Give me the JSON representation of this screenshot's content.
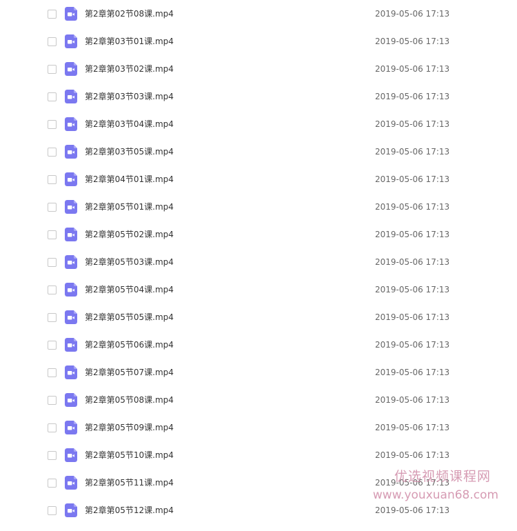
{
  "files": [
    {
      "name": "第2章第02节08课.mp4",
      "date": "2019-05-06 17:13"
    },
    {
      "name": "第2章第03节01课.mp4",
      "date": "2019-05-06 17:13"
    },
    {
      "name": "第2章第03节02课.mp4",
      "date": "2019-05-06 17:13"
    },
    {
      "name": "第2章第03节03课.mp4",
      "date": "2019-05-06 17:13"
    },
    {
      "name": "第2章第03节04课.mp4",
      "date": "2019-05-06 17:13"
    },
    {
      "name": "第2章第03节05课.mp4",
      "date": "2019-05-06 17:13"
    },
    {
      "name": "第2章第04节01课.mp4",
      "date": "2019-05-06 17:13"
    },
    {
      "name": "第2章第05节01课.mp4",
      "date": "2019-05-06 17:13"
    },
    {
      "name": "第2章第05节02课.mp4",
      "date": "2019-05-06 17:13"
    },
    {
      "name": "第2章第05节03课.mp4",
      "date": "2019-05-06 17:13"
    },
    {
      "name": "第2章第05节04课.mp4",
      "date": "2019-05-06 17:13"
    },
    {
      "name": "第2章第05节05课.mp4",
      "date": "2019-05-06 17:13"
    },
    {
      "name": "第2章第05节06课.mp4",
      "date": "2019-05-06 17:13"
    },
    {
      "name": "第2章第05节07课.mp4",
      "date": "2019-05-06 17:13"
    },
    {
      "name": "第2章第05节08课.mp4",
      "date": "2019-05-06 17:13"
    },
    {
      "name": "第2章第05节09课.mp4",
      "date": "2019-05-06 17:13"
    },
    {
      "name": "第2章第05节10课.mp4",
      "date": "2019-05-06 17:13"
    },
    {
      "name": "第2章第05节11课.mp4",
      "date": "2019-05-06 17:13"
    },
    {
      "name": "第2章第05节12课.mp4",
      "date": "2019-05-06 17:13"
    }
  ],
  "file_icon": "video-file-icon",
  "watermark": {
    "title": "优选视频课程网",
    "url": "www.youxuan68.com"
  },
  "colors": {
    "icon_bg": "#7b78f0",
    "date_text": "#666666",
    "name_text": "#333333",
    "watermark": "#cf8aa6"
  }
}
